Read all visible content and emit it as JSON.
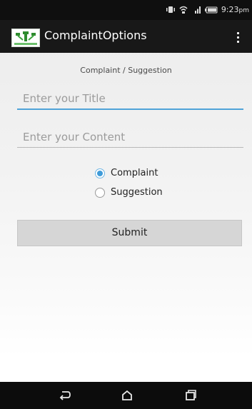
{
  "status_bar": {
    "time": "9:23",
    "time_suffix": "pm",
    "icons": [
      "vibrate-icon",
      "wifi-icon",
      "signal-icon",
      "battery-icon"
    ]
  },
  "action_bar": {
    "title": "ComplaintOptions",
    "logo_icon": "app-logo-icon",
    "menu_icon": "overflow-menu-icon"
  },
  "form": {
    "heading": "Complaint / Suggestion",
    "title_input": {
      "placeholder": "Enter your Title",
      "value": ""
    },
    "content_input": {
      "placeholder": "Enter your Content",
      "value": ""
    },
    "options": [
      {
        "label": "Complaint",
        "checked": true
      },
      {
        "label": "Suggestion",
        "checked": false
      }
    ],
    "submit_label": "Submit"
  },
  "nav_bar": {
    "buttons": [
      "back-icon",
      "home-icon",
      "recents-icon"
    ]
  },
  "colors": {
    "accent": "#3f9bd9",
    "bars": "#111111"
  }
}
